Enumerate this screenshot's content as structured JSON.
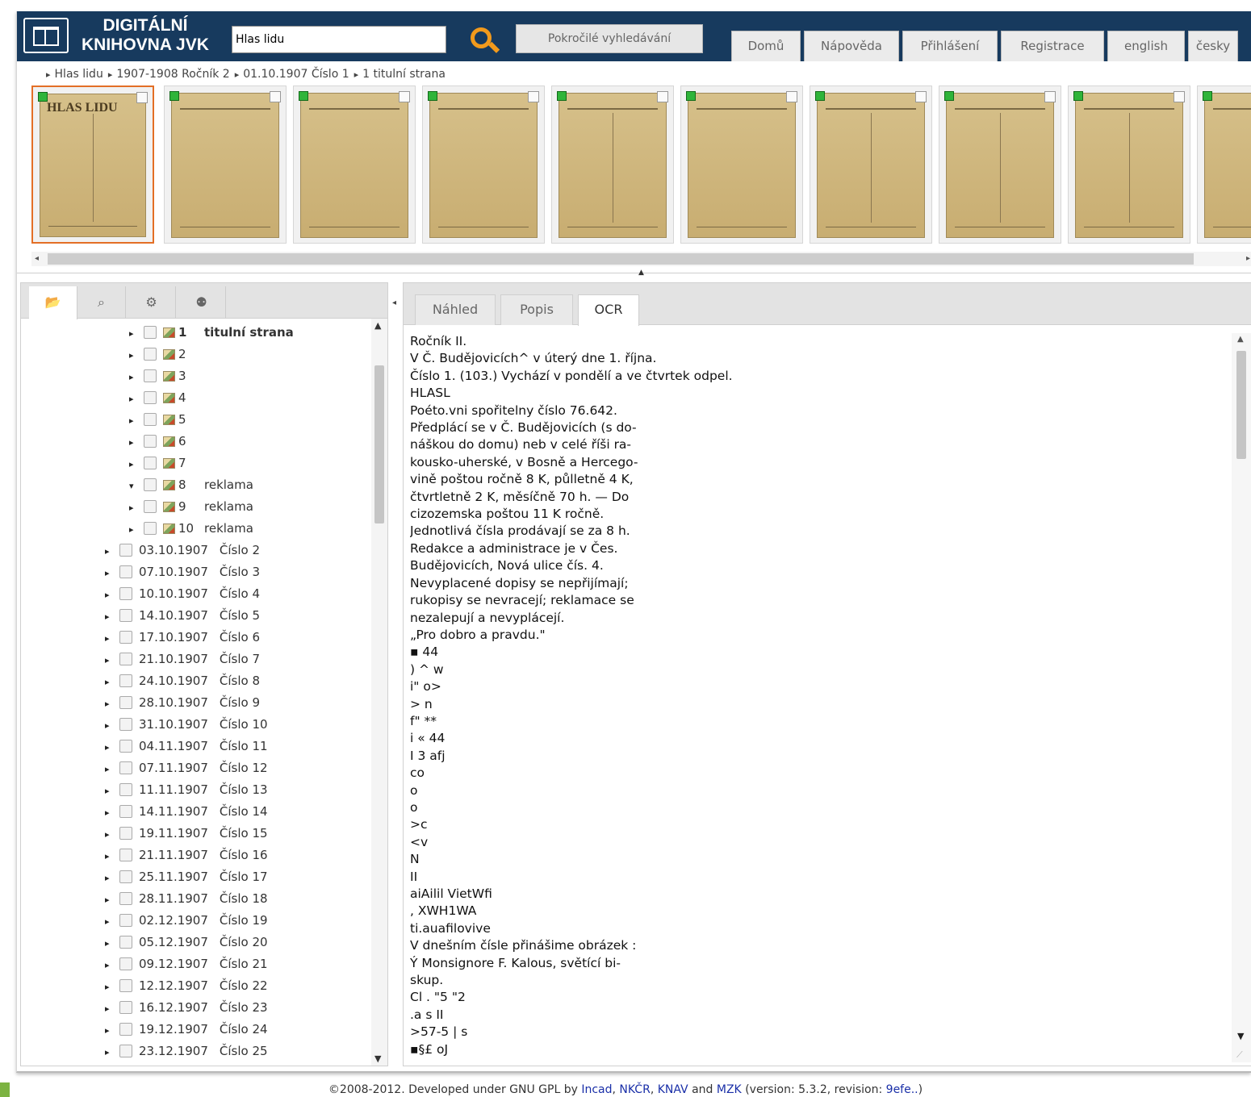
{
  "header": {
    "logo_line1": "DIGITÁLNÍ",
    "logo_line2": "KNIHOVNA JVK",
    "search_value": "Hlas lidu",
    "advanced_search": "Pokročilé vyhledávání",
    "nav": [
      "Domů",
      "Nápověda",
      "Přihlášení",
      "Registrace",
      "english",
      "česky"
    ],
    "brand_color": "#173a5e",
    "accent_color": "#f29a1c"
  },
  "breadcrumb": [
    "Hlas lidu",
    "1907-1908 Ročník 2",
    "01.10.1907 Číslo 1",
    "1 titulní strana"
  ],
  "thumbnails": {
    "first_page_title": "HLAS LIDU",
    "selected_index": 0,
    "selected_color": "#e36f26"
  },
  "left_tabs": [
    "folder-icon",
    "search-icon",
    "gear-icon",
    "bulb-icon"
  ],
  "tree": {
    "pages": [
      {
        "num": "1",
        "label": "titulní strana"
      },
      {
        "num": "2",
        "label": ""
      },
      {
        "num": "3",
        "label": ""
      },
      {
        "num": "4",
        "label": ""
      },
      {
        "num": "5",
        "label": ""
      },
      {
        "num": "6",
        "label": ""
      },
      {
        "num": "7",
        "label": ""
      },
      {
        "num": "8",
        "label": "reklama"
      },
      {
        "num": "9",
        "label": "reklama"
      },
      {
        "num": "10",
        "label": "reklama"
      }
    ],
    "issues": [
      {
        "date": "03.10.1907",
        "label": "Číslo 2"
      },
      {
        "date": "07.10.1907",
        "label": "Číslo 3"
      },
      {
        "date": "10.10.1907",
        "label": "Číslo 4"
      },
      {
        "date": "14.10.1907",
        "label": "Číslo 5"
      },
      {
        "date": "17.10.1907",
        "label": "Číslo 6"
      },
      {
        "date": "21.10.1907",
        "label": "Číslo 7"
      },
      {
        "date": "24.10.1907",
        "label": "Číslo 8"
      },
      {
        "date": "28.10.1907",
        "label": "Číslo 9"
      },
      {
        "date": "31.10.1907",
        "label": "Číslo 10"
      },
      {
        "date": "04.11.1907",
        "label": "Číslo 11"
      },
      {
        "date": "07.11.1907",
        "label": "Číslo 12"
      },
      {
        "date": "11.11.1907",
        "label": "Číslo 13"
      },
      {
        "date": "14.11.1907",
        "label": "Číslo 14"
      },
      {
        "date": "19.11.1907",
        "label": "Číslo 15"
      },
      {
        "date": "21.11.1907",
        "label": "Číslo 16"
      },
      {
        "date": "25.11.1907",
        "label": "Číslo 17"
      },
      {
        "date": "28.11.1907",
        "label": "Číslo 18"
      },
      {
        "date": "02.12.1907",
        "label": "Číslo 19"
      },
      {
        "date": "05.12.1907",
        "label": "Číslo 20"
      },
      {
        "date": "09.12.1907",
        "label": "Číslo 21"
      },
      {
        "date": "12.12.1907",
        "label": "Číslo 22"
      },
      {
        "date": "16.12.1907",
        "label": "Číslo 23"
      },
      {
        "date": "19.12.1907",
        "label": "Číslo 24"
      },
      {
        "date": "23.12.1907",
        "label": "Číslo 25"
      }
    ]
  },
  "right_tabs": [
    "Náhled",
    "Popis",
    "OCR"
  ],
  "ocr_lines": [
    "Ročník II.",
    "V Č. Budějovicích^ v úterý dne 1. října.",
    "Číslo 1. (103.) Vychází v pondělí a ve čtvrtek odpel.",
    "HLASL",
    "Poéto.vni spořitelny číslo 76.642.",
    "Předplácí se v Č. Budějovicích (s do-",
    "náškou do domu) neb v celé říši ra-",
    "kousko-uherské, v Bosně a Hercego-",
    "vině poštou ročně 8 K, půlletně 4 K,",
    "čtvrtletně 2 K, měsíčně 70 h. — Do",
    "cizozemska poštou 11 K ročně.",
    "Jednotlivá čísla prodávají se za 8 h.",
    "Redakce a administrace je v Čes.",
    "Budějovicích, Nová ulice čís. 4.",
    "Nevyplacené dopisy se nepřijímají;",
    "rukopisy se nevracejí; reklamace se",
    "nezalepují a nevyplácejí.",
    "„Pro dobro a pravdu.\"",
    "▪ 44",
    ") ^ w",
    "i\" o>",
    "> n",
    "f\" **",
    "i « 44",
    "I 3 afj",
    "co",
    "o",
    "o",
    ">c",
    "<v",
    "N",
    "II",
    "aiAilil VietWfi",
    ", XWH1WA",
    "ti.auafilovive",
    "V dnešním čísle přinášime obrázek :",
    "Ý Monsignore F. Kalous, světící bi-",
    "skup.",
    "Cl . \"5 \"2",
    ".a s II",
    ">57-5 | s",
    "▪§£ oJ"
  ],
  "footer": {
    "prefix": "©2008-2012. Developed under GNU GPL by ",
    "link1": "Incad",
    "sep1": ", ",
    "link2": "NKČR",
    "sep2": ", ",
    "link3": "KNAV",
    "mid": " and ",
    "link4": "MZK",
    "suffix1": " (version: 5.3.2, revision: ",
    "link5": "9efe..",
    "suffix2": ")"
  }
}
